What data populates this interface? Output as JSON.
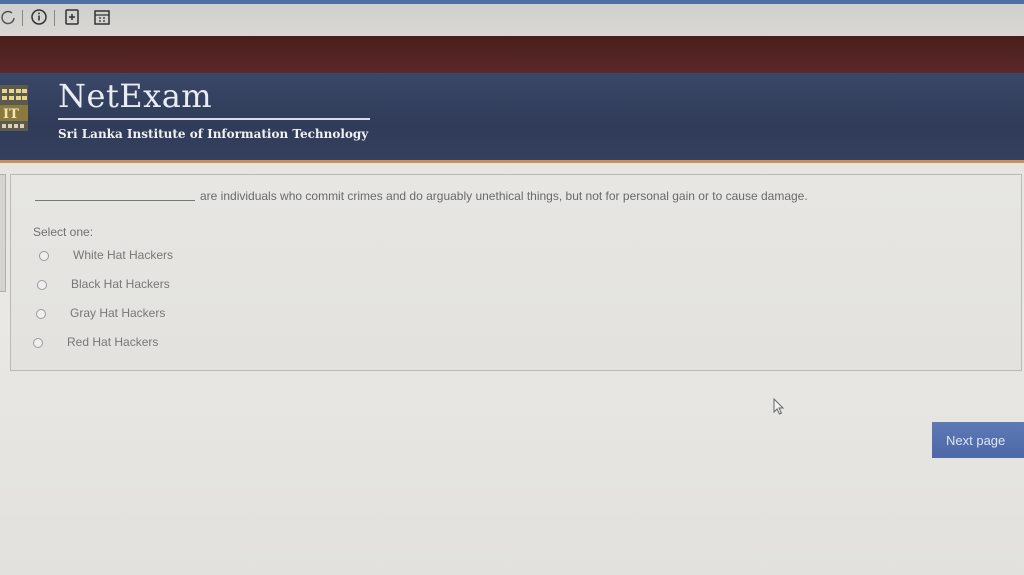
{
  "toolbar": {
    "icons": [
      "info-icon",
      "add-page-icon",
      "calendar-icon"
    ]
  },
  "header": {
    "title": "NetExam",
    "subtitle": "Sri Lanka Institute of Information Technology",
    "accent_color": "#c98f5e",
    "background_color": "#34405e"
  },
  "question": {
    "text": "are individuals who commit crimes and do arguably unethical things, but not for personal gain or to cause damage.",
    "select_label": "Select one:",
    "options": [
      {
        "label": "White Hat Hackers",
        "selected": false
      },
      {
        "label": "Black Hat Hackers",
        "selected": false
      },
      {
        "label": "Gray Hat Hackers",
        "selected": false
      },
      {
        "label": "Red Hat Hackers",
        "selected": false
      }
    ]
  },
  "actions": {
    "next_label": "Next page",
    "next_color": "#5570ad"
  }
}
